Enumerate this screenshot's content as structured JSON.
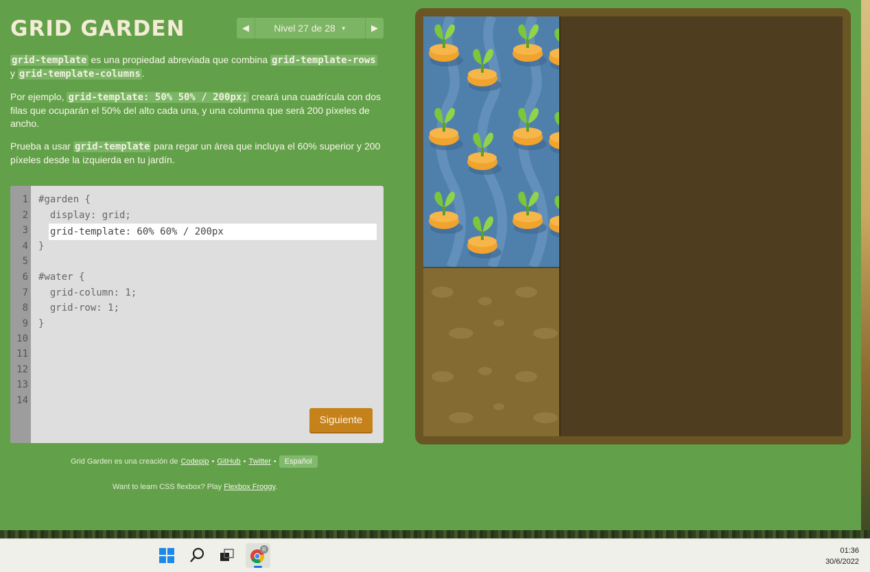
{
  "app": {
    "title": "GRID GARDEN",
    "level_label": "Nivel 27 de 28"
  },
  "instructions": {
    "p1": {
      "code1": "grid-template",
      "text1": " es una propiedad abreviada que combina ",
      "code2": "grid-template-rows",
      "text2": " y ",
      "code3": "grid-template-columns",
      "text3": "."
    },
    "p2": {
      "text1": "Por ejemplo, ",
      "code1": "grid-template: 50% 50% / 200px;",
      "text2": " creará una cuadrícula con dos filas que ocuparán el 50% del alto cada una, y una columna que será 200 píxeles de ancho."
    },
    "p3": {
      "text1": "Prueba a usar ",
      "code1": "grid-template",
      "text2": " para regar un área que incluya el 60% superior y 200 píxeles desde la izquierda en tu jardín."
    }
  },
  "editor": {
    "line_numbers": [
      "1",
      "2",
      "3",
      "4",
      "5",
      "6",
      "7",
      "8",
      "9",
      "10",
      "11",
      "12",
      "13",
      "14"
    ],
    "lines": {
      "l1": "#garden {",
      "l2": "  display: grid;",
      "l4": "}",
      "l6": "#water {",
      "l7": "  grid-column: 1;",
      "l8": "  grid-row: 1;",
      "l9": "}"
    },
    "input_value": "grid-template: 60% 60% / 200px",
    "next_label": "Siguiente"
  },
  "footer": {
    "credit_prefix": "Grid Garden es una creación de",
    "link_codepip": "Codepip",
    "sep": "•",
    "link_github": "GitHub",
    "link_twitter": "Twitter",
    "language": "Español",
    "flexbox_prefix": "Want to learn CSS flexbox? Play",
    "flexbox_link": "Flexbox Froggy",
    "flexbox_suffix": "."
  },
  "taskbar": {
    "time": "01:36",
    "date": "30/6/2022",
    "chrome_badge": "R"
  },
  "colors": {
    "background": "#62a14a",
    "accent_button": "#c5811a",
    "water": "#4f80ac",
    "soil": "#836b32",
    "carrot": "#f0a42e",
    "leaf": "#7cc63a"
  }
}
